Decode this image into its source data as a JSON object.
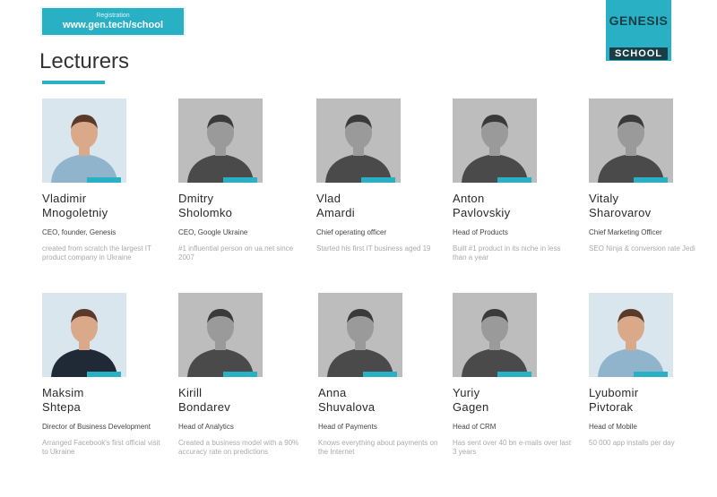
{
  "registration": {
    "label": "Registration",
    "url": "www.gen.tech/school"
  },
  "logo": {
    "top": "GENESIS",
    "bottom": "SCHOOL"
  },
  "page_title": "Lecturers",
  "colors": {
    "accent": "#2ab0c5",
    "logo_dark": "#1a3e45"
  },
  "lecturers": [
    {
      "first": "Vladimir",
      "last": "Mnogoletniy",
      "role": "CEO, founder, Genesis",
      "desc": "created from scratch the largest IT product company in Ukraine",
      "photo": "color"
    },
    {
      "first": "Dmitry",
      "last": "Sholomko",
      "role": "CEO, Google Ukraine",
      "desc": "#1 influential person on ua.net since 2007",
      "photo": "gray"
    },
    {
      "first": "Vlad",
      "last": "Amardi",
      "role": "Chief operating officer",
      "desc": "Started his first IT business aged 19",
      "photo": "gray"
    },
    {
      "first": "Anton",
      "last": "Pavlovskiy",
      "role": "Head of Products",
      "desc": "Built #1 product in its niche in less than a year",
      "photo": "gray"
    },
    {
      "first": "Vitaly",
      "last": "Sharovarov",
      "role": "Chief Marketing Officer",
      "desc": "SEO Ninja & conversion rate Jedi",
      "photo": "gray"
    },
    {
      "first": "Maksim",
      "last": "Shtepa",
      "role": "Director of Business Development",
      "desc": "Arranged Facebook's first official visit to Ukraine",
      "photo": "color"
    },
    {
      "first": "Kirill",
      "last": "Bondarev",
      "role": "Head of Analytics",
      "desc": "Created a business model with a 90% accuracy rate on predictions",
      "photo": "gray"
    },
    {
      "first": "Anna",
      "last": "Shuvalova",
      "role": "Head of Payments",
      "desc": "Knows everything about payments on the Internet",
      "photo": "gray"
    },
    {
      "first": "Yuriy",
      "last": "Gagen",
      "role": "Head of CRM",
      "desc": "Has sent over 40 bn e-mails over last 3 years",
      "photo": "gray"
    },
    {
      "first": "Lyubomir",
      "last": "Pivtorak",
      "role": "Head of Mobile",
      "desc": "50 000 app installs per day",
      "photo": "color"
    }
  ]
}
